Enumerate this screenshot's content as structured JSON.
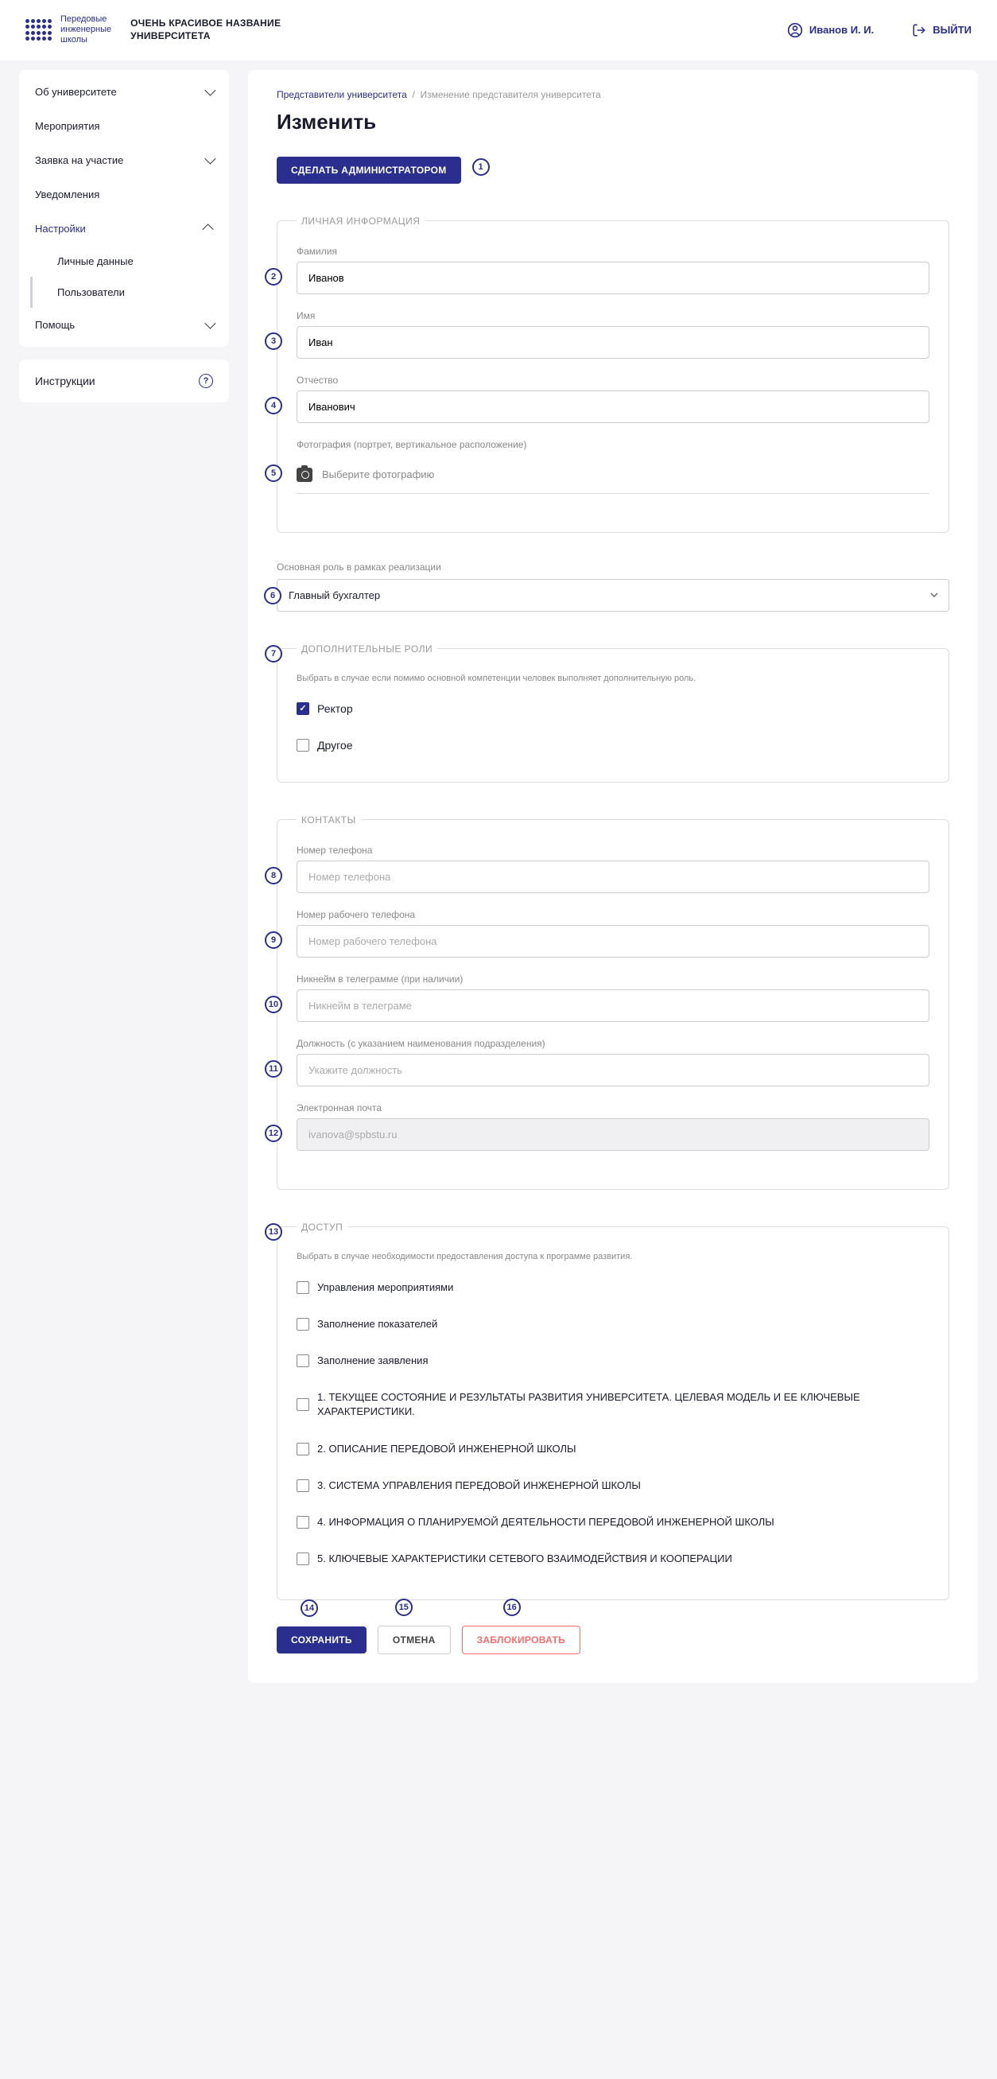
{
  "header": {
    "logo_text": "Передовые\nинженерные\nшколы",
    "university_name": "ОЧЕНЬ КРАСИВОЕ НАЗВАНИЕ УНИВЕРСИТЕТА",
    "user_name": "Иванов И. И.",
    "logout_label": "ВЫЙТИ"
  },
  "sidebar": {
    "items": [
      {
        "label": "Об университете",
        "expandable": true
      },
      {
        "label": "Мероприятия"
      },
      {
        "label": "Заявка на участие",
        "expandable": true
      },
      {
        "label": "Уведомления"
      },
      {
        "label": "Настройки",
        "expandable": true,
        "active": true,
        "sub": [
          {
            "label": "Личные данные"
          },
          {
            "label": "Пользователи"
          }
        ]
      },
      {
        "label": "Помощь",
        "expandable": true
      }
    ],
    "instructions_label": "Инструкции"
  },
  "breadcrumb": {
    "link": "Представители университета",
    "current": "Изменение представителя университета"
  },
  "page_title": "Изменить",
  "admin_button": "СДЕЛАТЬ АДМИНИСТРАТОРОМ",
  "markers": [
    "1",
    "2",
    "3",
    "4",
    "5",
    "6",
    "7",
    "8",
    "9",
    "10",
    "11",
    "12",
    "13",
    "14",
    "15",
    "16"
  ],
  "personal": {
    "legend": "ЛИЧНАЯ ИНФОРМАЦИЯ",
    "surname_label": "Фамилия",
    "surname_value": "Иванов",
    "name_label": "Имя",
    "name_value": "Иван",
    "patronymic_label": "Отчество",
    "patronymic_value": "Иванович",
    "photo_label": "Фотография (портрет, вертикальное расположение)",
    "photo_picker": "Выберите фотографию"
  },
  "main_role": {
    "label": "Основная роль в рамках реализации",
    "value": "Главный бухгалтер"
  },
  "extra_roles": {
    "legend": "ДОПОЛНИТЕЛЬНЫЕ РОЛИ",
    "hint": "Выбрать в случае если помимо основной компетенции человек выполняет дополнительную роль.",
    "options": [
      {
        "label": "Ректор",
        "checked": true
      },
      {
        "label": "Другое",
        "checked": false
      }
    ]
  },
  "contacts": {
    "legend": "КОНТАКТЫ",
    "phone_label": "Номер телефона",
    "phone_placeholder": "Номер телефона",
    "work_phone_label": "Номер рабочего телефона",
    "work_phone_placeholder": "Номер рабочего телефона",
    "telegram_label": "Никнейм в телеграмме (при наличии)",
    "telegram_placeholder": "Никнейм в телеграме",
    "position_label": "Должность (с указанием наименования подразделения)",
    "position_placeholder": "Укажите должность",
    "email_label": "Электронная почта",
    "email_value": "ivanova@spbstu.ru"
  },
  "access": {
    "legend": "ДОСТУП",
    "hint": "Выбрать в случае необходимости предоставления доступа к программе развития.",
    "options": [
      "Управления мероприятиями",
      "Заполнение показателей",
      "Заполнение заявления",
      "1. ТЕКУЩЕЕ СОСТОЯНИЕ И РЕЗУЛЬТАТЫ РАЗВИТИЯ УНИВЕРСИТЕТА. ЦЕЛЕВАЯ МОДЕЛЬ И ЕЕ КЛЮЧЕВЫЕ ХАРАКТЕРИСТИКИ.",
      "2. ОПИСАНИЕ ПЕРЕДОВОЙ ИНЖЕНЕРНОЙ ШКОЛЫ",
      "3. СИСТЕМА УПРАВЛЕНИЯ ПЕРЕДОВОЙ ИНЖЕНЕРНОЙ ШКОЛЫ",
      "4. ИНФОРМАЦИЯ О ПЛАНИРУЕМОЙ ДЕЯТЕЛЬНОСТИ ПЕРЕДОВОЙ ИНЖЕНЕРНОЙ ШКОЛЫ",
      "5. КЛЮЧЕВЫЕ ХАРАКТЕРИСТИКИ СЕТЕВОГО ВЗАИМОДЕЙСТВИЯ И КООПЕРАЦИИ"
    ]
  },
  "actions": {
    "save": "СОХРАНИТЬ",
    "cancel": "ОТМЕНА",
    "block": "ЗАБЛОКИРОВАТЬ"
  }
}
